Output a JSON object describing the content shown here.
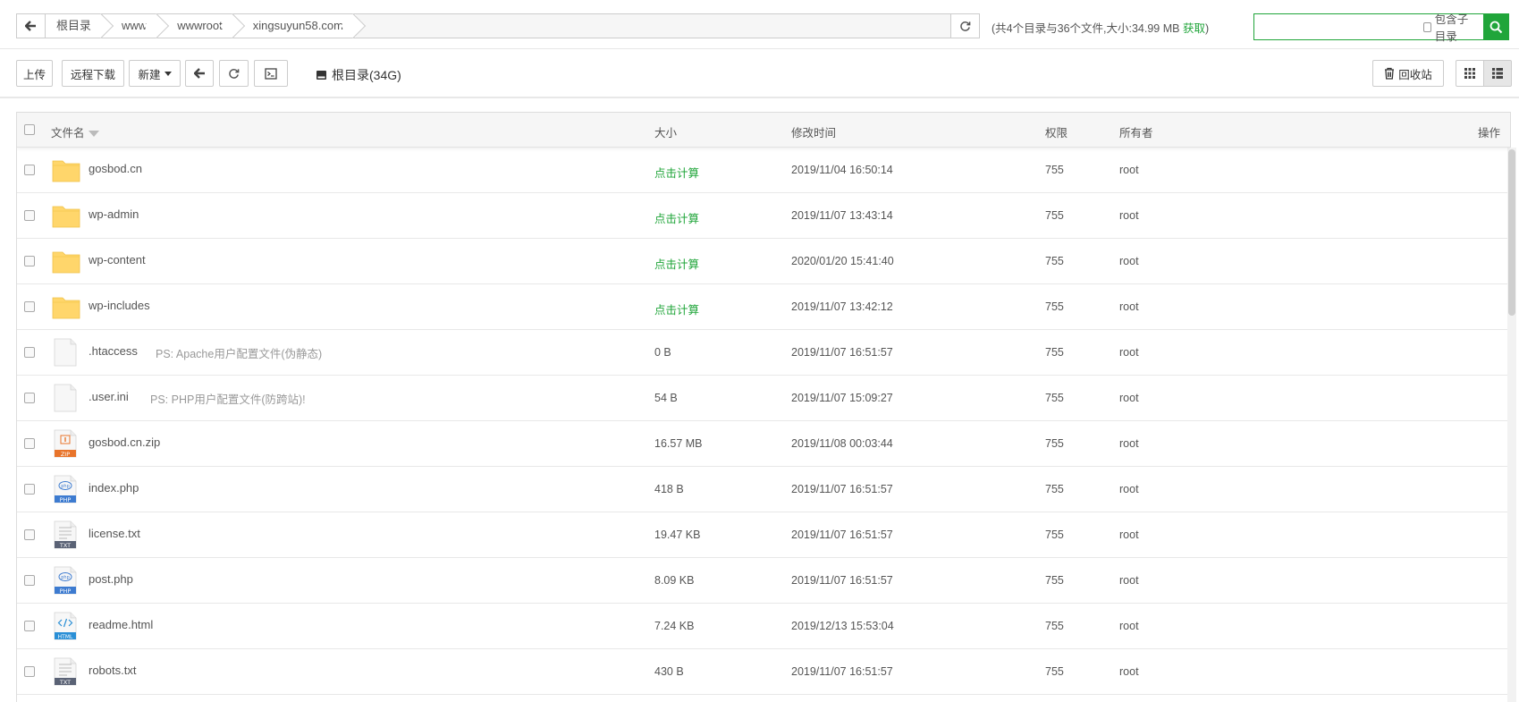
{
  "pathbar": {
    "crumbs": [
      "根目录",
      "www",
      "wwwroot",
      "xingsuyun58.com"
    ],
    "summary": "(共4个目录与36个文件,大小:34.99 MB ",
    "summary_link": "获取",
    "summary_end": ")"
  },
  "search": {
    "placeholder": "",
    "include_sub_label": "包含子目录"
  },
  "toolbar": {
    "upload": "上传",
    "remote_download": "远程下载",
    "new": "新建",
    "disk_label": "根目录(34G)",
    "recycle_bin": "回收站"
  },
  "table": {
    "headers": {
      "name": "文件名",
      "size": "大小",
      "mtime": "修改时间",
      "perm": "权限",
      "owner": "所有者",
      "action": "操作"
    },
    "rows": [
      {
        "name": "gosbod.cn",
        "type": "folder",
        "ps": "",
        "size": "点击计算",
        "mtime": "2019/11/04 16:50:14",
        "perm": "755",
        "owner": "root"
      },
      {
        "name": "wp-admin",
        "type": "folder",
        "ps": "",
        "size": "点击计算",
        "mtime": "2019/11/07 13:43:14",
        "perm": "755",
        "owner": "root"
      },
      {
        "name": "wp-content",
        "type": "folder",
        "ps": "",
        "size": "点击计算",
        "mtime": "2020/01/20 15:41:40",
        "perm": "755",
        "owner": "root"
      },
      {
        "name": "wp-includes",
        "type": "folder",
        "ps": "",
        "size": "点击计算",
        "mtime": "2019/11/07 13:42:12",
        "perm": "755",
        "owner": "root"
      },
      {
        "name": ".htaccess",
        "type": "blank",
        "ps": "PS: Apache用户配置文件(伪静态)",
        "size": "0 B",
        "mtime": "2019/11/07 16:51:57",
        "perm": "755",
        "owner": "root"
      },
      {
        "name": ".user.ini",
        "type": "blank",
        "ps": "PS: PHP用户配置文件(防跨站)!",
        "size": "54 B",
        "mtime": "2019/11/07 15:09:27",
        "perm": "755",
        "owner": "root"
      },
      {
        "name": "gosbod.cn.zip",
        "type": "zip",
        "ps": "",
        "size": "16.57 MB",
        "mtime": "2019/11/08 00:03:44",
        "perm": "755",
        "owner": "root"
      },
      {
        "name": "index.php",
        "type": "php",
        "ps": "",
        "size": "418 B",
        "mtime": "2019/11/07 16:51:57",
        "perm": "755",
        "owner": "root"
      },
      {
        "name": "license.txt",
        "type": "txt",
        "ps": "",
        "size": "19.47 KB",
        "mtime": "2019/11/07 16:51:57",
        "perm": "755",
        "owner": "root"
      },
      {
        "name": "post.php",
        "type": "php",
        "ps": "",
        "size": "8.09 KB",
        "mtime": "2019/11/07 16:51:57",
        "perm": "755",
        "owner": "root"
      },
      {
        "name": "readme.html",
        "type": "html",
        "ps": "",
        "size": "7.24 KB",
        "mtime": "2019/12/13 15:53:04",
        "perm": "755",
        "owner": "root"
      },
      {
        "name": "robots.txt",
        "type": "txt",
        "ps": "",
        "size": "430 B",
        "mtime": "2019/11/07 16:51:57",
        "perm": "755",
        "owner": "root"
      }
    ]
  },
  "icon_labels": {
    "zip": "ZIP",
    "php": "PHP",
    "txt": "TXT",
    "html": "HTML"
  },
  "colors": {
    "accent": "#20a53a",
    "folder": "#ffd66b",
    "zip": "#e8742b",
    "php": "#3d7bd0",
    "txt": "#5a6275",
    "html": "#2a8fd6"
  }
}
